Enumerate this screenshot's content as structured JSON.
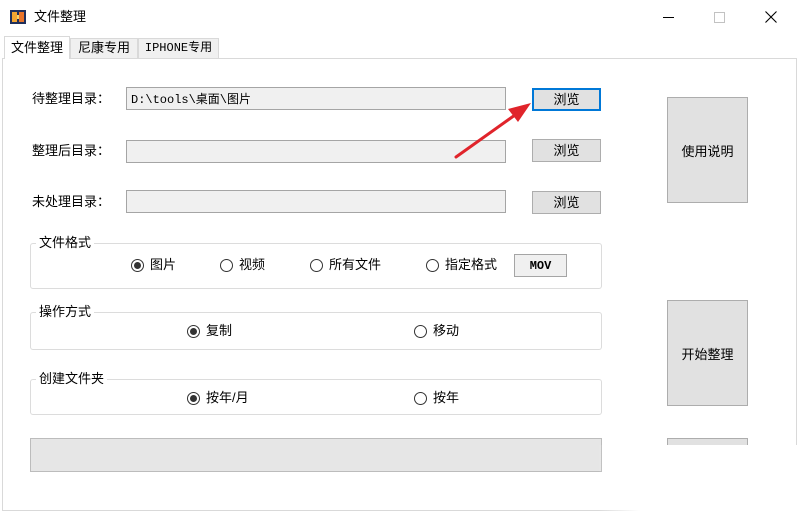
{
  "window": {
    "title": "文件整理",
    "icon": "app-icon",
    "controls": {
      "minimize": "minimize-icon",
      "maximize": "maximize-icon",
      "maximize_disabled": true,
      "close": "close-icon"
    }
  },
  "tabs": [
    {
      "label": "文件整理",
      "selected": true
    },
    {
      "label": "尼康专用",
      "selected": false
    },
    {
      "label": "IPHONE专用",
      "selected": false
    }
  ],
  "directories": [
    {
      "label": "待整理目录：",
      "value": "D:\\tools\\桌面\\图片",
      "browse_label": "浏览",
      "browse_focused": true
    },
    {
      "label": "整理后目录：",
      "value": "",
      "browse_label": "浏览",
      "browse_focused": false
    },
    {
      "label": "未处理目录：",
      "value": "",
      "browse_label": "浏览",
      "browse_focused": false
    }
  ],
  "file_format": {
    "title": "文件格式",
    "options": [
      {
        "label": "图片",
        "checked": true
      },
      {
        "label": "视频",
        "checked": false
      },
      {
        "label": "所有文件",
        "checked": false
      },
      {
        "label": "指定格式",
        "checked": false
      }
    ],
    "custom_format": "MOV"
  },
  "operation_mode": {
    "title": "操作方式",
    "options": [
      {
        "label": "复制",
        "checked": true
      },
      {
        "label": "移动",
        "checked": false
      }
    ]
  },
  "create_folder": {
    "title": "创建文件夹",
    "options": [
      {
        "label": "按年/月",
        "checked": true
      },
      {
        "label": "按年",
        "checked": false
      }
    ]
  },
  "progress": {
    "percent": 0
  },
  "side_buttons": {
    "help_label": "使用说明",
    "start_label": "开始整理"
  },
  "annotation": {
    "icon": "red-arrow-icon"
  },
  "colors": {
    "focus_border": "#0078d7",
    "annotation_arrow": "#e0242b",
    "button_face": "#e1e1e1",
    "readonly_field": "#f0f0f0",
    "progress_track": "#e6e6e6"
  }
}
